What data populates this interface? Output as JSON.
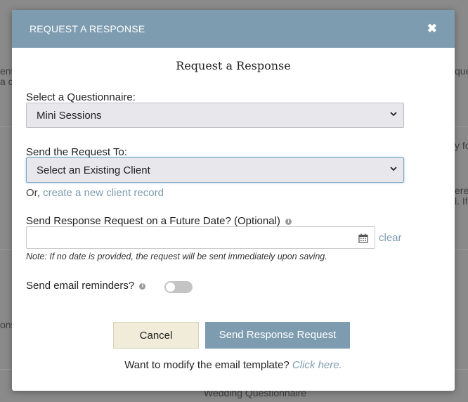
{
  "background": {
    "fragments": [
      "ent",
      "a c",
      "que",
      "y fo",
      "ere",
      "l. If",
      "ons",
      "Wedding Questionnaire"
    ]
  },
  "modal": {
    "header_title": "REQUEST A RESPONSE",
    "close_glyph": "✖",
    "heading": "Request a Response",
    "questionnaire_label": "Select a Questionnaire:",
    "questionnaire_value": "Mini Sessions",
    "send_to_label": "Send the Request To:",
    "send_to_value": "Select an Existing Client",
    "or_prefix": "Or, ",
    "create_client_link": "create a new client record",
    "future_date_label": "Send Response Request on a Future Date? (Optional)",
    "date_value": "",
    "clear_label": "clear",
    "note": "Note: If no date is provided, the request will be sent immediately upon saving.",
    "reminders_label": "Send email reminders?",
    "reminders_on": false,
    "cancel_label": "Cancel",
    "send_label": "Send Response Request",
    "footer_text": "Want to modify the email template? ",
    "footer_link": "Click here."
  },
  "colors": {
    "accent": "#7e9cb0",
    "cancel_bg": "#f1ecd9",
    "select_bg": "#e8e8ec"
  },
  "icons": {
    "close": "close-icon",
    "info": "info-icon",
    "calendar": "calendar-icon",
    "chevron": "chevron-down-icon"
  }
}
